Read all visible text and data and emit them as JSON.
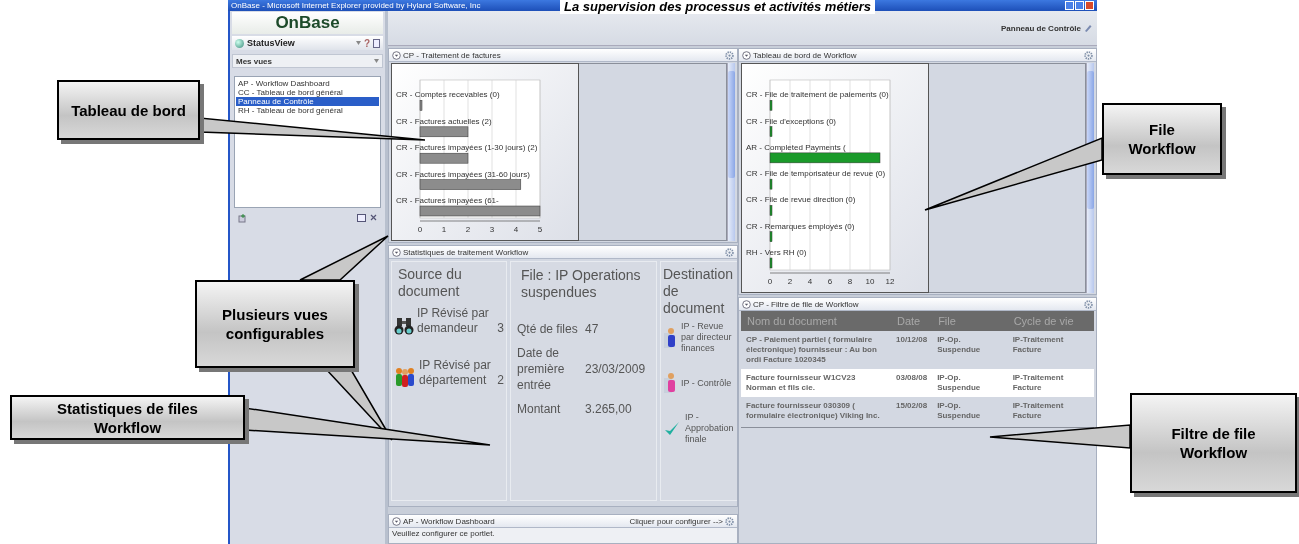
{
  "page_title": "La supervision des processus et activités métiers",
  "window": {
    "title": "OnBase - Microsoft Internet Explorer provided by Hyland Software, Inc"
  },
  "sidebar": {
    "logo": "OnBase",
    "app_name": "StatusView",
    "help": "?",
    "views_dropdown": "Mes vues",
    "views": [
      {
        "label": "AP - Workflow Dashboard",
        "selected": false
      },
      {
        "label": "CC - Tableau de bord général",
        "selected": false
      },
      {
        "label": "Panneau de Contrôle",
        "selected": true
      },
      {
        "label": "RH - Tableau de bord général",
        "selected": false
      }
    ]
  },
  "header": {
    "title": "Panneau de Contrôle"
  },
  "invoices": {
    "title": "CP - Traitement de factures",
    "chart_data": {
      "type": "bar",
      "orientation": "horizontal",
      "grid": true,
      "categories": [
        "CR - Comptes recevables (0)",
        "CR - Factures actuelles (2)",
        "CR - Factures impayées (1-30 jours) (2)",
        "CR - Factures impayées (31-60 jours)",
        "CR - Factures impayées (61-"
      ],
      "series": [
        {
          "color": "#8c8c8c",
          "values": [
            0,
            2,
            2,
            4.2,
            5
          ]
        }
      ],
      "xticks": [
        0,
        1,
        2,
        3,
        4,
        5
      ],
      "xlim": [
        0,
        5
      ]
    }
  },
  "dashboard": {
    "title": "Tableau de bord de Workflow",
    "chart_data": {
      "type": "bar",
      "orientation": "horizontal",
      "grid": true,
      "categories": [
        "CR - File de traitement de paiements (0)",
        "CR - File d'exceptions (0)",
        "AR - Completed Payments (",
        "CR - File de temporisateur de revue (0)",
        "CR - File de revue direction (0)",
        "CR - Remarques employés (0)",
        "RH - Vers RH (0)"
      ],
      "series": [
        {
          "color": "#1a9a2a",
          "values": [
            0,
            0,
            11,
            0,
            0,
            0,
            0
          ]
        }
      ],
      "xticks": [
        0,
        2,
        4,
        6,
        8,
        10,
        12
      ],
      "xlim": [
        0,
        12
      ]
    }
  },
  "stats": {
    "title": "Statistiques de traitement Workflow",
    "source": {
      "heading": "Source du document",
      "items": [
        {
          "kind": "binoculars",
          "label": "IP Révisé par demandeur",
          "count": "3"
        },
        {
          "kind": "people",
          "label": "IP Révisé par département",
          "count": "2"
        }
      ]
    },
    "queue": {
      "heading": "File : IP Operations suspendues",
      "fields": [
        {
          "label": "Qté de files",
          "value": "47"
        },
        {
          "label": "Date de première entrée",
          "value": "23/03/2009"
        },
        {
          "label": "Montant",
          "value": "3.265,00"
        }
      ]
    },
    "destination": {
      "heading": "Destination de document",
      "items": [
        {
          "kind": "person-blue",
          "label": "IP - Revue par directeur finances"
        },
        {
          "kind": "person-pink",
          "label": "IP - Contrôle"
        },
        {
          "kind": "check",
          "label": "IP - Approbation finale"
        }
      ]
    }
  },
  "filter": {
    "title": "CP - Filtre de file de Workflow",
    "columns": [
      "Nom du document",
      "Date",
      "File",
      "Cycle de vie"
    ],
    "rows": [
      {
        "cells": [
          "CP - Paiement partiel ( formulaire électronique) fournisseur : Au bon ordi Facture 1020345",
          "10/12/08",
          "IP-Op. Suspendue",
          "IP-Traitement Facture"
        ],
        "selected": false
      },
      {
        "cells": [
          "Facture fournisseur W1CV23 Norman et fils cie.",
          "03/08/08",
          "IP-Op. Suspendue",
          "IP-Traitement Facture"
        ],
        "selected": true
      },
      {
        "cells": [
          "Facture fournisseur 030309 ( formulaire électronique) Viking Inc.",
          "15/02/08",
          "IP-Op. Suspendue",
          "IP-Traitement Facture"
        ],
        "selected": false
      }
    ]
  },
  "ap": {
    "title": "AP - Workflow Dashboard",
    "action": "Cliquer pour configurer -->",
    "message": "Veuillez configurer ce portlet."
  },
  "callouts": [
    {
      "text": "Tableau de bord"
    },
    {
      "text": "File Workflow"
    },
    {
      "text": "Plusieurs vues configurables"
    },
    {
      "text": "Statistiques de files Workflow"
    },
    {
      "text": "Filtre de file Workflow"
    }
  ]
}
